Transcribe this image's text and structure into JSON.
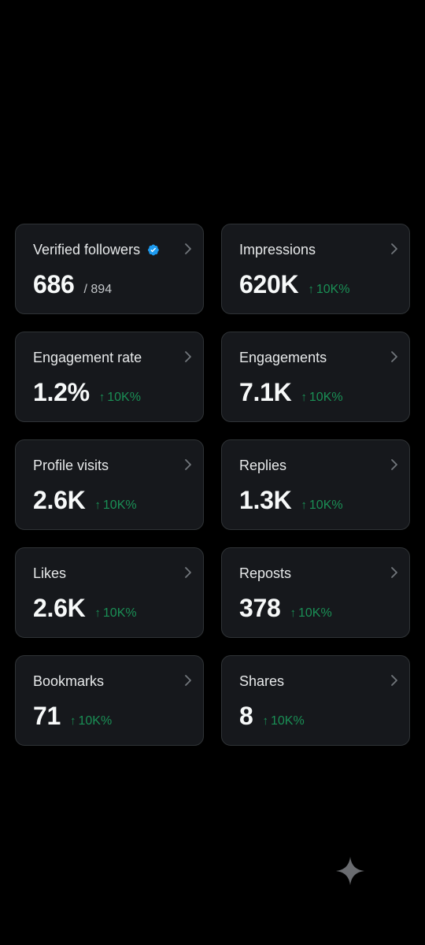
{
  "metrics": [
    {
      "title": "Verified followers",
      "value": "686",
      "total": "/ 894",
      "change": "",
      "verified": true
    },
    {
      "title": "Impressions",
      "value": "620K",
      "total": "",
      "change": "10K%"
    },
    {
      "title": "Engagement rate",
      "value": "1.2%",
      "total": "",
      "change": "10K%"
    },
    {
      "title": "Engagements",
      "value": "7.1K",
      "total": "",
      "change": "10K%"
    },
    {
      "title": "Profile visits",
      "value": "2.6K",
      "total": "",
      "change": "10K%"
    },
    {
      "title": "Replies",
      "value": "1.3K",
      "total": "",
      "change": "10K%"
    },
    {
      "title": "Likes",
      "value": "2.6K",
      "total": "",
      "change": "10K%"
    },
    {
      "title": "Reposts",
      "value": "378",
      "total": "",
      "change": "10K%"
    },
    {
      "title": "Bookmarks",
      "value": "71",
      "total": "",
      "change": "10K%"
    },
    {
      "title": "Shares",
      "value": "8",
      "total": "",
      "change": "10K%"
    }
  ],
  "arrow_glyph": "↑",
  "colors": {
    "background": "#000000",
    "card": "#16181c",
    "card_border": "#2f3336",
    "positive_change": "#1a8f55",
    "verified_badge": "#1d9bf0"
  },
  "icons": {
    "verified": "verified-badge-icon",
    "chevron": "chevron-right-icon",
    "sparkle": "sparkle-icon"
  }
}
